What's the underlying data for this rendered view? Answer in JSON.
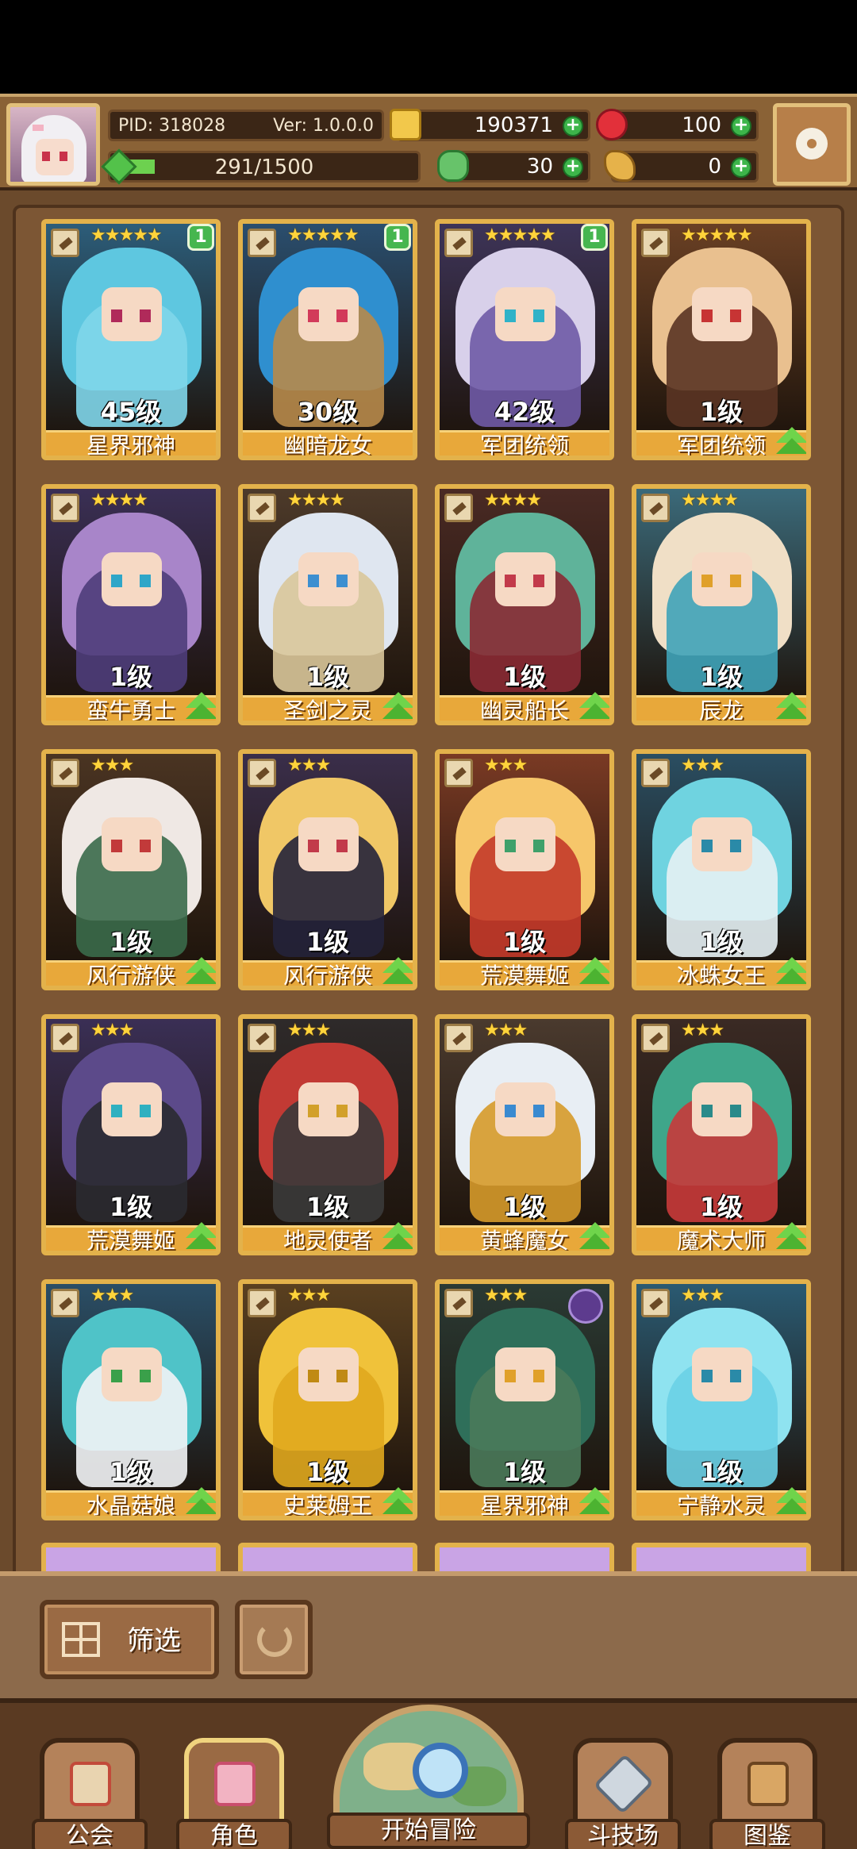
{
  "header": {
    "pid_label": "PID: 318028",
    "version_label": "Ver: 1.0.0.0",
    "xp_text": "291/1500",
    "xp_progress": 0.194,
    "gold": "190371",
    "gems": "100",
    "clover": "30",
    "bread": "0"
  },
  "cards": [
    {
      "stars": "★★★★★",
      "badge": "1",
      "level": "45级",
      "name": "星界邪神",
      "upgrade": false,
      "hair": "#5ec7e0",
      "body": "#7fd6ea",
      "eye": "#b02a5a",
      "bg": "#2c5d7a"
    },
    {
      "stars": "★★★★★",
      "badge": "1",
      "level": "30级",
      "name": "幽暗龙女",
      "upgrade": false,
      "hair": "#2f8fcf",
      "body": "#b78a4a",
      "eye": "#d23a5a",
      "bg": "#2a4e6e"
    },
    {
      "stars": "★★★★★",
      "badge": "1",
      "level": "42级",
      "name": "军团统领",
      "upgrade": false,
      "hair": "#d8d0ea",
      "body": "#6f5aa6",
      "eye": "#2fb2c8",
      "bg": "#3d3458"
    },
    {
      "stars": "★★★★★",
      "badge": "",
      "level": "1级",
      "name": "军团统领",
      "upgrade": true,
      "hair": "#e9c08f",
      "body": "#5a3424",
      "eye": "#c73434",
      "bg": "#6a4024"
    },
    {
      "stars": "★★★★",
      "badge": "",
      "level": "1级",
      "name": "蛮牛勇士",
      "upgrade": true,
      "hair": "#a885c9",
      "body": "#4e3d7a",
      "eye": "#2fa6c8",
      "bg": "#3a2f55"
    },
    {
      "stars": "★★★★",
      "badge": "",
      "level": "1级",
      "name": "圣剑之灵",
      "upgrade": true,
      "hair": "#dfe6f0",
      "body": "#d9c79a",
      "eye": "#3d8fd0",
      "bg": "#4d3a2a"
    },
    {
      "stars": "★★★★",
      "badge": "",
      "level": "1级",
      "name": "幽灵船长",
      "upgrade": true,
      "hair": "#5fb39a",
      "body": "#8a2a34",
      "eye": "#c23a4a",
      "bg": "#4a2a24"
    },
    {
      "stars": "★★★★",
      "badge": "",
      "level": "1级",
      "name": "辰龙",
      "upgrade": true,
      "hair": "#f0dfc6",
      "body": "#3fa3b8",
      "eye": "#e0a02a",
      "bg": "#3b6a7a"
    },
    {
      "stars": "★★★",
      "badge": "",
      "level": "1级",
      "name": "风行游侠",
      "upgrade": true,
      "hair": "#efe8e4",
      "body": "#3a6a4a",
      "eye": "#c23a3a",
      "bg": "#4a3422"
    },
    {
      "stars": "★★★",
      "badge": "",
      "level": "1级",
      "name": "风行游侠",
      "upgrade": true,
      "hair": "#f0c766",
      "body": "#23223a",
      "eye": "#c23a4a",
      "bg": "#3a2e4a"
    },
    {
      "stars": "★★★",
      "badge": "",
      "level": "1级",
      "name": "荒漠舞姬",
      "upgrade": true,
      "hair": "#f6c66a",
      "body": "#c43a2a",
      "eye": "#3fa06a",
      "bg": "#7a3a24"
    },
    {
      "stars": "★★★",
      "badge": "",
      "level": "1级",
      "name": "冰蛛女王",
      "upgrade": true,
      "hair": "#6fd3e0",
      "body": "#e6f1f4",
      "eye": "#2a8aa8",
      "bg": "#2a4e62"
    },
    {
      "stars": "★★★",
      "badge": "",
      "level": "1级",
      "name": "荒漠舞姬",
      "upgrade": true,
      "hair": "#5c4a8a",
      "body": "#2a2a30",
      "eye": "#2fb0c0",
      "bg": "#3a2f55"
    },
    {
      "stars": "★★★",
      "badge": "",
      "level": "1级",
      "name": "地灵使者",
      "upgrade": true,
      "hair": "#c23a34",
      "body": "#3a3a3a",
      "eye": "#d2a02a",
      "bg": "#2e2a2a"
    },
    {
      "stars": "★★★",
      "badge": "",
      "level": "1级",
      "name": "黄蜂魔女",
      "upgrade": true,
      "hair": "#e8eef4",
      "body": "#d69a2a",
      "eye": "#3a8ad0",
      "bg": "#4a3a2e"
    },
    {
      "stars": "★★★",
      "badge": "",
      "level": "1级",
      "name": "魔术大师",
      "upgrade": true,
      "hair": "#3fa68a",
      "body": "#c83a3a",
      "eye": "#2a8a8a",
      "bg": "#3a2a24"
    },
    {
      "stars": "★★★",
      "badge": "",
      "level": "1级",
      "name": "水晶菇娘",
      "upgrade": true,
      "hair": "#4fc3c8",
      "body": "#f2f4f6",
      "eye": "#3aa04a",
      "bg": "#2a4e66"
    },
    {
      "stars": "★★★",
      "badge": "",
      "level": "1级",
      "name": "史莱姆王",
      "upgrade": true,
      "hair": "#f0c23a",
      "body": "#e0a81e",
      "eye": "#c08a14",
      "bg": "#5a4020"
    },
    {
      "stars": "★★★",
      "badge": "",
      "level": "1级",
      "name": "星界邪神",
      "upgrade": true,
      "hair": "#2f6f5a",
      "body": "#4a7a5a",
      "eye": "#e0a02a",
      "bg": "#2a3a34",
      "emblem": true
    },
    {
      "stars": "★★★",
      "badge": "",
      "level": "1级",
      "name": "宁静水灵",
      "upgrade": true,
      "hair": "#8fe3f0",
      "body": "#6ad0e6",
      "eye": "#2a8aa8",
      "bg": "#2a5a72"
    }
  ],
  "filter": {
    "label": "筛选"
  },
  "nav": {
    "guild": "公会",
    "character": "角色",
    "adventure": "开始冒险",
    "arena": "斗技场",
    "codex": "图鉴"
  }
}
